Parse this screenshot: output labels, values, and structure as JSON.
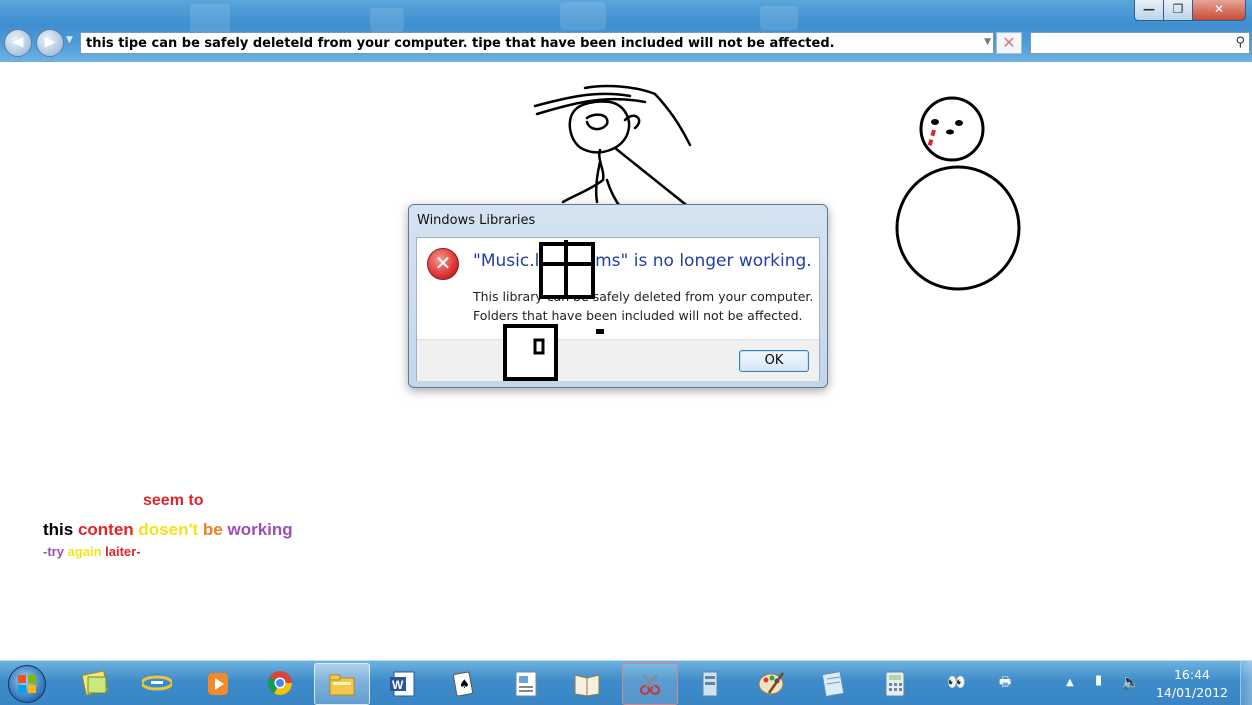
{
  "window_controls": {
    "minimize": "—",
    "maximize": "❐",
    "close": "✕"
  },
  "nav": {
    "back": "◀",
    "forward": "▶"
  },
  "address": {
    "text": "this tipe can be safely deleteld from your computer. tipe that have been included will not be affected."
  },
  "search": {
    "placeholder": ""
  },
  "dialog": {
    "title": "Windows Libraries",
    "heading": "\"Music.library-ms\" is no longer working.",
    "message_line1": "This library can be safely deleted from your computer.",
    "message_line2": "Folders that have been included will not be affected.",
    "ok_label": "OK"
  },
  "colored_text": {
    "line1": [
      {
        "text": "seem to",
        "color": "#e0252b"
      }
    ],
    "line2": [
      {
        "text": "this ",
        "color": "#000000"
      },
      {
        "text": "conten ",
        "color": "#e0252b"
      },
      {
        "text": "dosen't ",
        "color": "#f4e21a"
      },
      {
        "text": "be ",
        "color": "#f07e24"
      },
      {
        "text": "working",
        "color": "#9b4fb8"
      }
    ],
    "line3": [
      {
        "text": "-try ",
        "color": "#9b4fb8"
      },
      {
        "text": "again ",
        "color": "#f4e21a"
      },
      {
        "text": "laiter-",
        "color": "#e0252b"
      }
    ]
  },
  "taskbar": {
    "pinned": [
      {
        "name": "sticky-notes-icon"
      },
      {
        "name": "internet-explorer-icon"
      },
      {
        "name": "media-player-icon"
      },
      {
        "name": "chrome-icon"
      },
      {
        "name": "windows-explorer-icon",
        "active": true
      },
      {
        "name": "word-icon"
      },
      {
        "name": "solitaire-icon"
      },
      {
        "name": "wordpad-icon"
      },
      {
        "name": "book-icon"
      },
      {
        "name": "snipping-tool-icon",
        "highlighted": true
      },
      {
        "name": "server-icon"
      },
      {
        "name": "paint-icon"
      },
      {
        "name": "notepad-icon"
      },
      {
        "name": "calculator-icon"
      }
    ],
    "clock": {
      "time": "16:44",
      "date": "14/01/2012"
    }
  },
  "colors": {
    "taskbar": "#3d8bc9",
    "dialog_heading": "#1f3ea8",
    "error_red": "#d33333"
  }
}
